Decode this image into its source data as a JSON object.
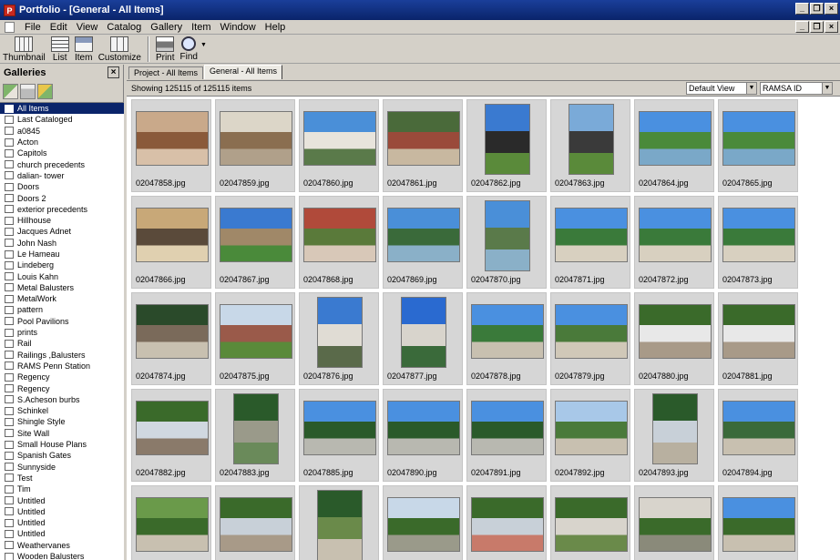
{
  "window": {
    "title": "Portfolio - [General - All Items]",
    "app_icon_letter": "P"
  },
  "menu": [
    "File",
    "Edit",
    "View",
    "Catalog",
    "Gallery",
    "Item",
    "Window",
    "Help"
  ],
  "toolbar": [
    {
      "label": "Thumbnail",
      "icon": "thumbnail-view-icon"
    },
    {
      "label": "List",
      "icon": "list-view-icon"
    },
    {
      "label": "Item",
      "icon": "item-view-icon"
    },
    {
      "label": "Customize",
      "icon": "customize-icon"
    },
    {
      "label": "Print",
      "icon": "printer-icon"
    },
    {
      "label": "Find",
      "icon": "magnifier-icon"
    }
  ],
  "galleries": {
    "title": "Galleries",
    "items": [
      "All Items",
      "Last Cataloged",
      "a0845",
      "Acton",
      "Capitols",
      "church precedents",
      "dalian- tower",
      "Doors",
      "Doors 2",
      "exterior precedents",
      "Hillhouse",
      "Jacques Adnet",
      "John Nash",
      "Le Hameau",
      "Lindeberg",
      "Louis Kahn",
      "Metal Balusters",
      "MetalWork",
      "pattern",
      "Pool Pavilions",
      "prints",
      "Rail",
      "Railings ,Balusters",
      "RAMS Penn Station",
      "Regency",
      "Regency",
      "S.Acheson burbs",
      "Schinkel",
      "Shingle Style",
      "Site Wall",
      "Small House Plans",
      "Spanish Gates",
      "Sunnyside",
      "Test",
      "Tim",
      "Untitled",
      "Untitled",
      "Untitled",
      "Untitled",
      "Weathervanes",
      "Wooden Balusters"
    ],
    "selected_index": 0
  },
  "tabs": [
    {
      "label": "Project - All Items",
      "active": false
    },
    {
      "label": "General - All Items",
      "active": true
    }
  ],
  "status": {
    "showing": "Showing 125115 of 125115 items",
    "view_select": "Default View",
    "field_select": "RAMSA ID"
  },
  "thumbnails": [
    {
      "name": "02047858.jpg",
      "orient": "land",
      "colors": [
        "#c9a98a",
        "#8a5a3a",
        "#d8c0a8"
      ]
    },
    {
      "name": "02047859.jpg",
      "orient": "land",
      "colors": [
        "#dcd6c8",
        "#8a6e50",
        "#b0a08a"
      ]
    },
    {
      "name": "02047860.jpg",
      "orient": "land",
      "colors": [
        "#4a8fd8",
        "#e8e4dc",
        "#5a7a4a"
      ]
    },
    {
      "name": "02047861.jpg",
      "orient": "land",
      "colors": [
        "#4a6a3a",
        "#9a4a3a",
        "#c8b8a0"
      ]
    },
    {
      "name": "02047862.jpg",
      "orient": "port",
      "colors": [
        "#3a7ad0",
        "#2a2a2a",
        "#5a8a3a"
      ]
    },
    {
      "name": "02047863.jpg",
      "orient": "port",
      "colors": [
        "#7aaad8",
        "#3a3a3a",
        "#5a8a3a"
      ]
    },
    {
      "name": "02047864.jpg",
      "orient": "land",
      "colors": [
        "#4a90e0",
        "#4a8a3a",
        "#7aa8c8"
      ]
    },
    {
      "name": "02047865.jpg",
      "orient": "land",
      "colors": [
        "#4a90e0",
        "#4a8a3a",
        "#7aa8c8"
      ]
    },
    {
      "name": "02047866.jpg",
      "orient": "land",
      "colors": [
        "#c8a878",
        "#5a4a3a",
        "#e0d0b0"
      ]
    },
    {
      "name": "02047867.jpg",
      "orient": "land",
      "colors": [
        "#3a7ad0",
        "#a08868",
        "#4a8a3a"
      ]
    },
    {
      "name": "02047868.jpg",
      "orient": "land",
      "colors": [
        "#b04a3a",
        "#5a7a3a",
        "#d8c8b8"
      ]
    },
    {
      "name": "02047869.jpg",
      "orient": "land",
      "colors": [
        "#4a8fd8",
        "#3a6a3a",
        "#8ab0c8"
      ]
    },
    {
      "name": "02047870.jpg",
      "orient": "port",
      "colors": [
        "#4a8fd8",
        "#5a7a4a",
        "#8ab0c8"
      ]
    },
    {
      "name": "02047871.jpg",
      "orient": "land",
      "colors": [
        "#4a90e0",
        "#3a7a3a",
        "#d8d0c0"
      ]
    },
    {
      "name": "02047872.jpg",
      "orient": "land",
      "colors": [
        "#4a90e0",
        "#3a7a3a",
        "#d8d0c0"
      ]
    },
    {
      "name": "02047873.jpg",
      "orient": "land",
      "colors": [
        "#4a90e0",
        "#3a7a3a",
        "#d8d0c0"
      ]
    },
    {
      "name": "02047874.jpg",
      "orient": "land",
      "colors": [
        "#2a4a2a",
        "#7a6a5a",
        "#c8c0b0"
      ]
    },
    {
      "name": "02047875.jpg",
      "orient": "land",
      "colors": [
        "#c8d8e8",
        "#9a5a4a",
        "#5a8a3a"
      ]
    },
    {
      "name": "02047876.jpg",
      "orient": "port",
      "colors": [
        "#3a7ad0",
        "#e0dcd4",
        "#5a6a4a"
      ]
    },
    {
      "name": "02047877.jpg",
      "orient": "port",
      "colors": [
        "#2a6ad0",
        "#d8d4cc",
        "#3a6a3a"
      ]
    },
    {
      "name": "02047878.jpg",
      "orient": "land",
      "colors": [
        "#4a90e0",
        "#3a7a3a",
        "#c8c0b0"
      ]
    },
    {
      "name": "02047879.jpg",
      "orient": "land",
      "colors": [
        "#4a90e0",
        "#4a7a3a",
        "#d0c8b8"
      ]
    },
    {
      "name": "02047880.jpg",
      "orient": "land",
      "colors": [
        "#3a6a2a",
        "#e8e8e8",
        "#a89a88"
      ]
    },
    {
      "name": "02047881.jpg",
      "orient": "land",
      "colors": [
        "#3a6a2a",
        "#e8e8e8",
        "#a89a88"
      ]
    },
    {
      "name": "02047882.jpg",
      "orient": "land",
      "colors": [
        "#3a6a2a",
        "#d0d8e0",
        "#8a7a6a"
      ]
    },
    {
      "name": "02047883.jpg",
      "orient": "port",
      "colors": [
        "#2a5a2a",
        "#9a9a8a",
        "#6a8a5a"
      ]
    },
    {
      "name": "02047885.jpg",
      "orient": "land",
      "colors": [
        "#4a90e0",
        "#2a5a2a",
        "#b8b8b0"
      ]
    },
    {
      "name": "02047890.jpg",
      "orient": "land",
      "colors": [
        "#4a90e0",
        "#2a5a2a",
        "#b8b8b0"
      ]
    },
    {
      "name": "02047891.jpg",
      "orient": "land",
      "colors": [
        "#4a90e0",
        "#2a5a2a",
        "#b8b8b0"
      ]
    },
    {
      "name": "02047892.jpg",
      "orient": "land",
      "colors": [
        "#a8c8e8",
        "#4a7a3a",
        "#c8c0b0"
      ]
    },
    {
      "name": "02047893.jpg",
      "orient": "port",
      "colors": [
        "#2a5a2a",
        "#c8d0d8",
        "#b8b0a0"
      ]
    },
    {
      "name": "02047894.jpg",
      "orient": "land",
      "colors": [
        "#4a90e0",
        "#3a6a3a",
        "#c8c0b0"
      ]
    },
    {
      "name": "",
      "orient": "land",
      "colors": [
        "#6a9a4a",
        "#3a6a2a",
        "#c8c0b0"
      ]
    },
    {
      "name": "",
      "orient": "land",
      "colors": [
        "#3a6a2a",
        "#c8d0d8",
        "#a89a88"
      ]
    },
    {
      "name": "",
      "orient": "port",
      "colors": [
        "#2a5a2a",
        "#6a8a4a",
        "#c8c0b0"
      ]
    },
    {
      "name": "",
      "orient": "land",
      "colors": [
        "#c8d8e8",
        "#3a6a2a",
        "#9a9a8a"
      ]
    },
    {
      "name": "",
      "orient": "land",
      "colors": [
        "#3a6a2a",
        "#c8d0d8",
        "#c87a6a"
      ]
    },
    {
      "name": "",
      "orient": "land",
      "colors": [
        "#3a6a2a",
        "#d8d4cc",
        "#6a8a4a"
      ]
    },
    {
      "name": "",
      "orient": "land",
      "colors": [
        "#d8d4cc",
        "#3a6a2a",
        "#8a8a7a"
      ]
    },
    {
      "name": "",
      "orient": "land",
      "colors": [
        "#4a90e0",
        "#3a6a2a",
        "#c8c0b0"
      ]
    }
  ]
}
